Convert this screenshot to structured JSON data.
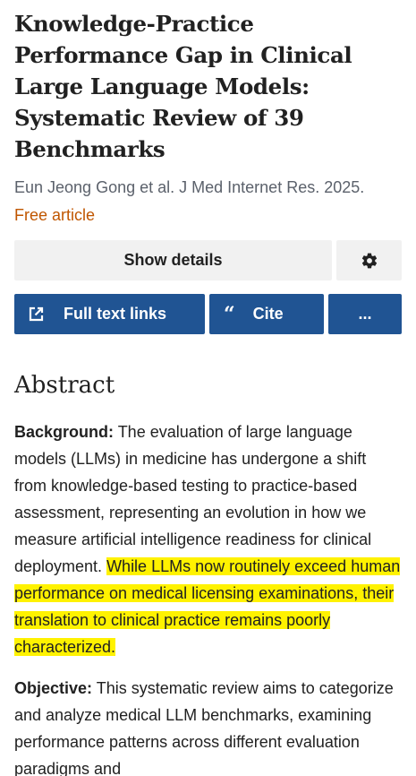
{
  "article": {
    "title": "Knowledge-Practice Performance Gap in Clinical Large Language Models: Systematic Review of 39 Benchmarks",
    "authors_citation": "Eun Jeong Gong et al. J Med Internet Res. 2025.",
    "free_label": "Free article"
  },
  "actions": {
    "show_details": "Show details",
    "settings_icon": "gear-icon",
    "full_text_links": "Full text links",
    "cite": "Cite",
    "more": "...",
    "button_color": "#205493"
  },
  "abstract": {
    "heading": "Abstract",
    "background_label": "Background:",
    "background_text": " The evaluation of large language models (LLMs) in medicine has undergone a shift from knowledge-based testing to practice-based assessment, representing an evolution in how we measure artificial intelligence readiness for clinical deployment. ",
    "background_highlight": "While LLMs now routinely exceed human performance on medical licensing examinations, their translation to clinical practice remains poorly characterized.",
    "objective_label": "Objective:",
    "objective_text": " This systematic review aims to categorize and analyze medical LLM benchmarks, examining performance patterns across different evaluation paradigms and",
    "highlight_color": "#fff200"
  }
}
